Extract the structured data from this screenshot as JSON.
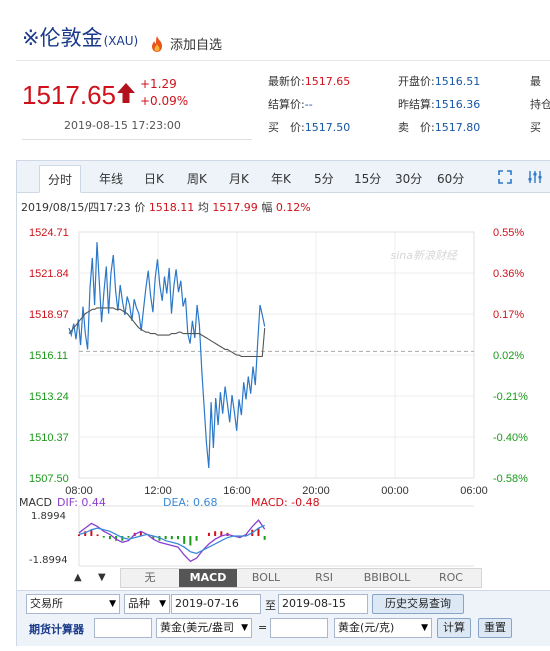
{
  "header": {
    "title": "※伦敦金",
    "symbol": "(XAU)",
    "add_favorite": "添加自选"
  },
  "quote": {
    "price": "1517.65",
    "change": "+1.29",
    "change_pct": "+0.09%",
    "time": "2019-08-15 17:23:00",
    "fields": [
      {
        "label": "最新价:",
        "value": "1517.65"
      },
      {
        "label": "开盘价:",
        "value": "1516.51"
      },
      {
        "label": "最",
        "value": ""
      },
      {
        "label": "结算价:",
        "value": "--"
      },
      {
        "label": "昨结算:",
        "value": "1516.36"
      },
      {
        "label": "持仓",
        "value": ""
      },
      {
        "label": "买　价:",
        "value": "1517.50"
      },
      {
        "label": "卖　价:",
        "value": "1517.80"
      },
      {
        "label": "买",
        "value": ""
      }
    ]
  },
  "tabs": [
    "分时",
    "年线",
    "日K",
    "周K",
    "月K",
    "年K",
    "5分",
    "15分",
    "30分",
    "60分"
  ],
  "info_bar": {
    "date": "2019/08/15/四17:23",
    "price_label": "价",
    "price": "1518.11",
    "avg_label": "均",
    "avg": "1517.99",
    "amp_label": "幅",
    "amp": "0.12%"
  },
  "watermark": "sina新浪财经",
  "macd_legend": {
    "name": "MACD",
    "dif": "DIF: 0.44",
    "dea": "DEA: 0.68",
    "macd": "MACD: -0.48"
  },
  "macd_ticks": [
    "1.8994",
    "-1.8994"
  ],
  "indicator_tabs": [
    "无",
    "MACD",
    "BOLL",
    "RSI",
    "BBIBOLL",
    "ROC"
  ],
  "nav": {
    "up": "▲",
    "down": "▼"
  },
  "form": {
    "exchange": "交易所",
    "variety": "品种",
    "date_from": "2019-07-16",
    "to": "至",
    "date_to": "2019-08-15",
    "history_button": "历史交易查询",
    "calc_label": "期货计算器",
    "unit_from": "黄金(美元/盎司",
    "equals": "=",
    "unit_to": "黄金(元/克)",
    "calc_button": "计算",
    "reset_button": "重置"
  },
  "colors": {
    "up": "#d0111b",
    "down": "#1a9a1a",
    "price_line": "#2b78c8",
    "avg_line": "#555555",
    "dif_line": "#8a3fd0",
    "dea_line": "#3a8ad8"
  },
  "chart_data": {
    "type": "line",
    "price_axis_ticks": [
      "1524.71",
      "1521.84",
      "1518.97",
      "1516.11",
      "1513.24",
      "1510.37",
      "1507.50"
    ],
    "pct_axis_ticks": [
      "0.55%",
      "0.36%",
      "0.17%",
      "0.02%",
      "-0.21%",
      "-0.40%",
      "-0.58%"
    ],
    "time_ticks": [
      "08:00",
      "12:00",
      "16:00",
      "20:00",
      "00:00",
      "06:00"
    ],
    "ylim": [
      1507.5,
      1524.71
    ],
    "reference": 1516.36,
    "series": [
      {
        "name": "价",
        "values": [
          1518.0,
          1517.5,
          1518.3,
          1517.2,
          1518.6,
          1516.8,
          1519.5,
          1517.6,
          1516.5,
          1520.8,
          1522.9,
          1519.6,
          1524.0,
          1521.2,
          1518.4,
          1520.5,
          1522.3,
          1519.0,
          1521.8,
          1523.1,
          1520.6,
          1519.2,
          1521.0,
          1519.8,
          1518.9,
          1520.2,
          1519.6,
          1518.5,
          1520.0,
          1519.4,
          1519.0,
          1517.8,
          1519.3,
          1520.8,
          1522.0,
          1520.3,
          1519.1,
          1521.5,
          1522.8,
          1521.0,
          1519.9,
          1521.6,
          1520.4,
          1522.2,
          1519.0,
          1520.9,
          1522.1,
          1520.5,
          1521.3,
          1519.5,
          1520.1,
          1517.6,
          1516.9,
          1518.5,
          1517.3,
          1519.6,
          1518.2,
          1515.0,
          1512.5,
          1510.0,
          1508.2,
          1512.8,
          1509.6,
          1513.1,
          1511.2,
          1513.5,
          1512.0,
          1513.9,
          1512.7,
          1511.4,
          1513.3,
          1512.1,
          1510.8,
          1513.0,
          1511.9,
          1514.2,
          1513.0,
          1514.6,
          1513.4,
          1515.3,
          1514.0,
          1517.0,
          1519.6,
          1518.9,
          1518.1
        ]
      },
      {
        "name": "均",
        "values": [
          1517.6,
          1517.8,
          1518.0,
          1518.2,
          1518.4,
          1518.6,
          1518.8,
          1519.0,
          1519.1,
          1519.2,
          1519.3,
          1519.3,
          1519.4,
          1519.4,
          1519.4,
          1519.4,
          1519.4,
          1519.4,
          1519.4,
          1519.4,
          1519.3,
          1519.3,
          1519.3,
          1519.2,
          1519.1,
          1519.0,
          1518.8,
          1518.6,
          1518.4,
          1518.2,
          1518.0,
          1517.9,
          1517.8,
          1517.7,
          1517.7,
          1517.6,
          1517.6,
          1517.6,
          1517.5,
          1517.5,
          1517.5,
          1517.5,
          1517.5,
          1517.5,
          1517.6,
          1517.6,
          1517.6,
          1517.7,
          1517.7,
          1517.6,
          1517.6,
          1517.6,
          1517.6,
          1517.6,
          1517.6,
          1517.6,
          1517.6,
          1517.5,
          1517.4,
          1517.3,
          1517.2,
          1517.1,
          1517.0,
          1516.9,
          1516.8,
          1516.7,
          1516.6,
          1516.5,
          1516.5,
          1516.4,
          1516.3,
          1516.2,
          1516.1,
          1516.1,
          1516.0,
          1516.0,
          1516.0,
          1516.0,
          1516.0,
          1516.0,
          1516.0,
          1516.0,
          1516.0,
          1516.0,
          1517.99
        ]
      }
    ],
    "macd": {
      "ylim": [
        -1.8994,
        1.8994
      ],
      "dif": [
        0.2,
        0.5,
        0.8,
        0.6,
        0.3,
        0.1,
        -0.2,
        -0.4,
        -0.3,
        0.1,
        0.3,
        0.1,
        -0.2,
        -0.4,
        -0.5,
        -0.6,
        -0.7,
        -1.2,
        -1.6,
        -1.4,
        -0.9,
        -0.5,
        -0.2,
        0.0,
        0.1,
        0.0,
        -0.1,
        0.1,
        0.6,
        1.0,
        0.44
      ],
      "dea": [
        0.1,
        0.2,
        0.4,
        0.5,
        0.4,
        0.3,
        0.1,
        -0.1,
        -0.2,
        -0.1,
        0.0,
        0.1,
        0.0,
        -0.1,
        -0.3,
        -0.4,
        -0.5,
        -0.7,
        -1.0,
        -1.1,
        -0.9,
        -0.7,
        -0.5,
        -0.3,
        -0.1,
        0.0,
        0.0,
        0.0,
        0.2,
        0.5,
        0.68
      ],
      "hist": [
        0.2,
        0.6,
        0.8,
        0.2,
        -0.2,
        -0.4,
        -0.6,
        -0.6,
        -0.2,
        0.4,
        0.6,
        0.0,
        -0.4,
        -0.6,
        -0.4,
        -0.4,
        -0.4,
        -1.0,
        -1.2,
        -0.6,
        0.0,
        0.4,
        0.6,
        0.6,
        0.4,
        0.0,
        -0.2,
        0.2,
        0.8,
        1.0,
        -0.48
      ]
    }
  }
}
